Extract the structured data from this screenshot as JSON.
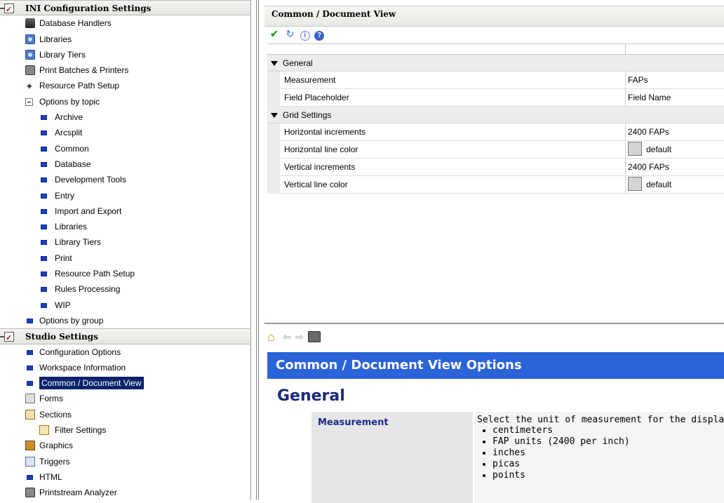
{
  "tree": {
    "items": [
      {
        "label": "INI Configuration Settings",
        "kind": "section",
        "icon": "settings-section-icon",
        "indent": 0
      },
      {
        "label": "Database Handlers",
        "kind": "item",
        "icon": "database-icon",
        "indent": 1
      },
      {
        "label": "Libraries",
        "kind": "item",
        "icon": "library-icon",
        "indent": 1
      },
      {
        "label": "Library Tiers",
        "kind": "item",
        "icon": "library-icon",
        "indent": 1
      },
      {
        "label": "Print Batches & Printers",
        "kind": "item",
        "icon": "printer-icon",
        "indent": 1
      },
      {
        "label": "Resource Path Setup",
        "kind": "item",
        "icon": "resource-path-icon",
        "indent": 1
      },
      {
        "label": "Options by topic",
        "kind": "group",
        "icon": "collapse-minus-icon",
        "indent": 1
      },
      {
        "label": "Archive",
        "kind": "item",
        "icon": "topic-square-icon",
        "indent": 2
      },
      {
        "label": "Arcsplit",
        "kind": "item",
        "icon": "topic-square-icon",
        "indent": 2
      },
      {
        "label": "Common",
        "kind": "item",
        "icon": "topic-square-icon",
        "indent": 2
      },
      {
        "label": "Database",
        "kind": "item",
        "icon": "topic-square-icon",
        "indent": 2
      },
      {
        "label": "Development Tools",
        "kind": "item",
        "icon": "topic-square-icon",
        "indent": 2
      },
      {
        "label": "Entry",
        "kind": "item",
        "icon": "topic-square-icon",
        "indent": 2
      },
      {
        "label": "Import and Export",
        "kind": "item",
        "icon": "topic-square-icon",
        "indent": 2
      },
      {
        "label": "Libraries",
        "kind": "item",
        "icon": "topic-square-icon",
        "indent": 2
      },
      {
        "label": "Library Tiers",
        "kind": "item",
        "icon": "topic-square-icon",
        "indent": 2
      },
      {
        "label": "Print",
        "kind": "item",
        "icon": "topic-square-icon",
        "indent": 2
      },
      {
        "label": "Resource Path Setup",
        "kind": "item",
        "icon": "topic-square-icon",
        "indent": 2
      },
      {
        "label": "Rules Processing",
        "kind": "item",
        "icon": "topic-square-icon",
        "indent": 2
      },
      {
        "label": "WIP",
        "kind": "item",
        "icon": "topic-square-icon",
        "indent": 2
      },
      {
        "label": "Options by group",
        "kind": "item",
        "icon": "topic-square-icon",
        "indent": 1
      },
      {
        "label": "Studio Settings",
        "kind": "section",
        "icon": "settings-section-icon",
        "indent": 0
      },
      {
        "label": "Configuration Options",
        "kind": "item",
        "icon": "topic-square-icon",
        "indent": 1
      },
      {
        "label": "Workspace Information",
        "kind": "item",
        "icon": "topic-square-icon",
        "indent": 1
      },
      {
        "label": "Common / Document View",
        "kind": "item",
        "icon": "topic-square-icon",
        "indent": 1,
        "selected": true
      },
      {
        "label": "Forms",
        "kind": "item",
        "icon": "forms-icon",
        "indent": 1
      },
      {
        "label": "Sections",
        "kind": "group",
        "icon": "sections-icon",
        "indent": 1
      },
      {
        "label": "Filter Settings",
        "kind": "item",
        "icon": "filter-icon",
        "indent": 2
      },
      {
        "label": "Graphics",
        "kind": "item",
        "icon": "graphics-icon",
        "indent": 1
      },
      {
        "label": "Triggers",
        "kind": "item",
        "icon": "triggers-icon",
        "indent": 1
      },
      {
        "label": "HTML",
        "kind": "item",
        "icon": "topic-square-icon",
        "indent": 1
      },
      {
        "label": "Printstream Analyzer",
        "kind": "item",
        "icon": "printer-icon",
        "indent": 1
      }
    ]
  },
  "panel": {
    "title": "Common / Document View",
    "toolbar": [
      {
        "name": "apply-check-icon",
        "glyph": "✔"
      },
      {
        "name": "refresh-icon",
        "glyph": "↻"
      },
      {
        "name": "info-icon",
        "glyph": "i"
      },
      {
        "name": "help-icon",
        "glyph": "?"
      }
    ],
    "categories": [
      {
        "label": "General",
        "rows": [
          {
            "name": "Measurement",
            "value": "FAPs",
            "swatch": false
          },
          {
            "name": "Field Placeholder",
            "value": "Field Name",
            "swatch": false
          }
        ]
      },
      {
        "label": "Grid Settings",
        "rows": [
          {
            "name": "Horizontal increments",
            "value": "2400 FAPs",
            "swatch": false
          },
          {
            "name": "Horizontal line color",
            "value": "default",
            "swatch": true
          },
          {
            "name": "Vertical increments",
            "value": "2400 FAPs",
            "swatch": false
          },
          {
            "name": "Vertical line color",
            "value": "default",
            "swatch": true
          }
        ]
      }
    ]
  },
  "help": {
    "nav": [
      "home-icon",
      "back-arrow-icon",
      "forward-arrow-icon",
      "print-icon"
    ],
    "title": "Common / Document View Options",
    "heading": "General",
    "term": "Measurement",
    "description": "Select the unit of measurement for the display",
    "options": [
      "centimeters",
      "FAP units (2400 per inch)",
      "inches",
      "picas",
      "points"
    ]
  },
  "colors": {
    "selection": "#0a246a",
    "help_title_bg": "#2b63d8",
    "heading": "#1a2a7a",
    "topic_square": "#1a3fbf"
  }
}
